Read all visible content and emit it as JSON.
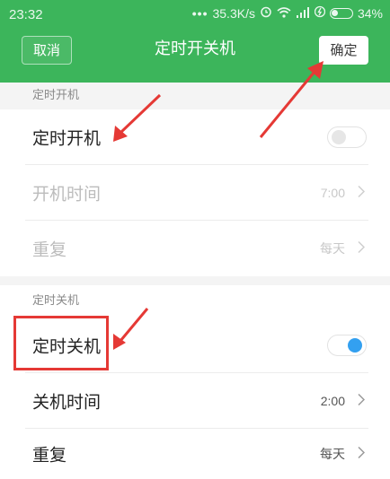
{
  "status_bar": {
    "time": "23:32",
    "network_speed": "35.3K/s",
    "battery_percent": "34%",
    "battery_level": 0.34,
    "icons": [
      "more-dots-icon",
      "alarm-icon",
      "wifi-icon",
      "signal-icon",
      "data-icon",
      "battery-icon"
    ]
  },
  "header": {
    "cancel_label": "取消",
    "title": "定时开关机",
    "confirm_label": "确定"
  },
  "power_on": {
    "section_title": "定时开机",
    "toggle_label": "定时开机",
    "toggle_on": false,
    "time_label": "开机时间",
    "time_value": "7:00",
    "repeat_label": "重复",
    "repeat_value": "每天"
  },
  "power_off": {
    "section_title": "定时关机",
    "toggle_label": "定时关机",
    "toggle_on": true,
    "time_label": "关机时间",
    "time_value": "2:00",
    "repeat_label": "重复",
    "repeat_value": "每天"
  },
  "colors": {
    "header_green": "#3cb55b",
    "toggle_on_blue": "#33a0f0",
    "annotation_red": "#e53935"
  }
}
